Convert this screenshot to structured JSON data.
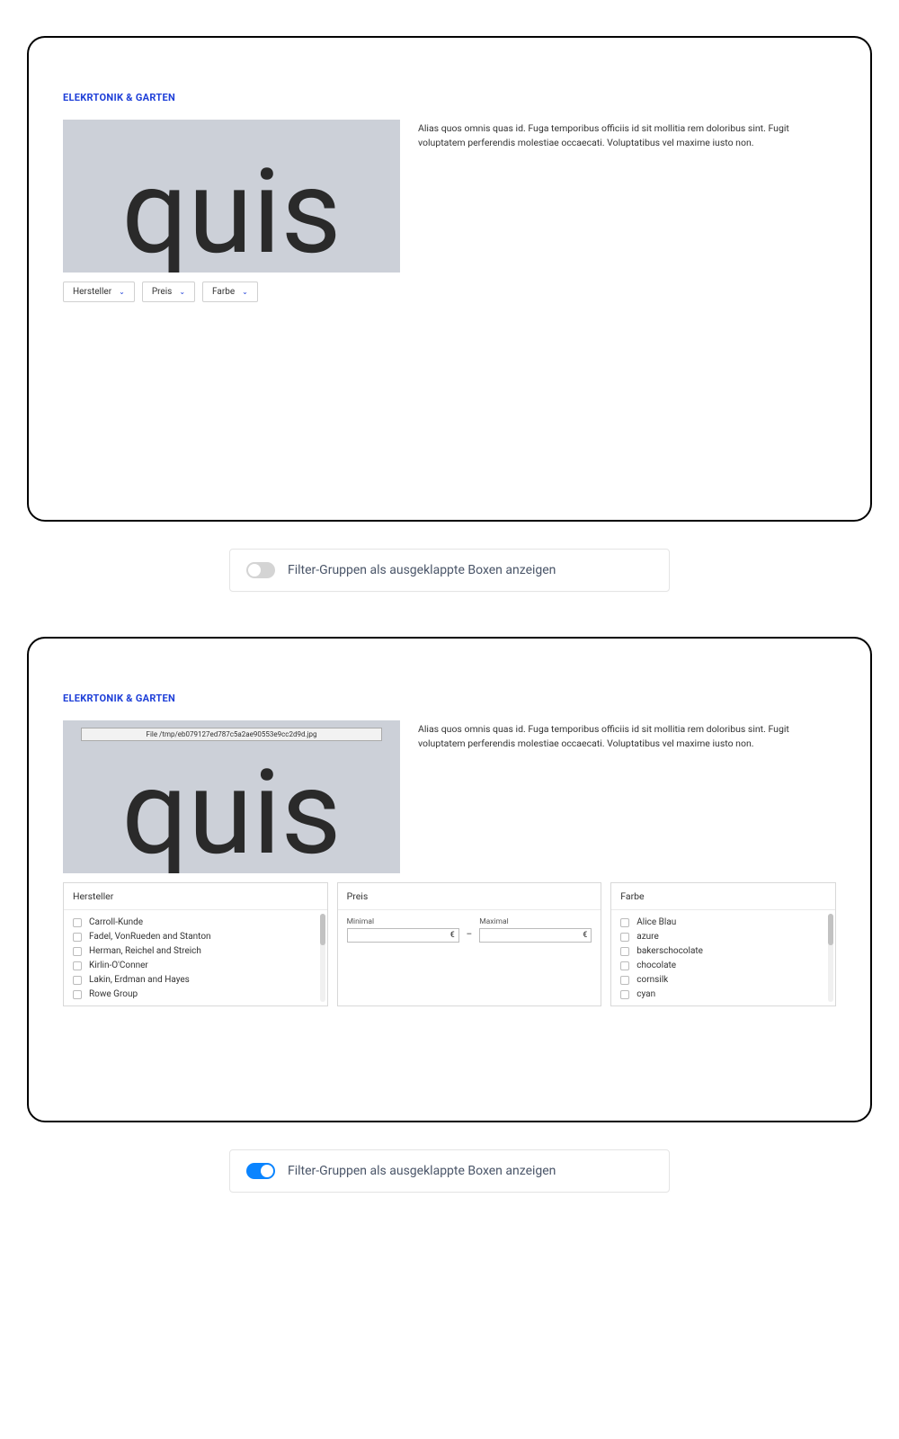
{
  "category_title": "ELEKRTONIK & GARTEN",
  "hero_word": "quis",
  "description": "Alias quos omnis quas id. Fuga temporibus officiis id sit mollitia rem doloribus sint. Fugit voluptatem perferendis molestiae occaecati. Voluptatibus vel maxime iusto non.",
  "file_path": "File /tmp/eb079127ed787c5a2ae90553e9cc2d9d.jpg",
  "dropdowns": {
    "hersteller": "Hersteller",
    "preis": "Preis",
    "farbe": "Farbe"
  },
  "filter_boxes": {
    "hersteller": {
      "title": "Hersteller",
      "items": [
        "Carroll-Kunde",
        "Fadel, VonRueden and Stanton",
        "Herman, Reichel and Streich",
        "Kirlin-O'Conner",
        "Lakin, Erdman and Hayes",
        "Rowe Group"
      ]
    },
    "preis": {
      "title": "Preis",
      "min_label": "Minimal",
      "max_label": "Maximal",
      "currency": "€",
      "dash": "–"
    },
    "farbe": {
      "title": "Farbe",
      "items": [
        "Alice Blau",
        "azure",
        "bakerschocolate",
        "chocolate",
        "cornsilk",
        "cyan"
      ]
    }
  },
  "toggle_label": "Filter-Gruppen als ausgeklappte Boxen anzeigen"
}
